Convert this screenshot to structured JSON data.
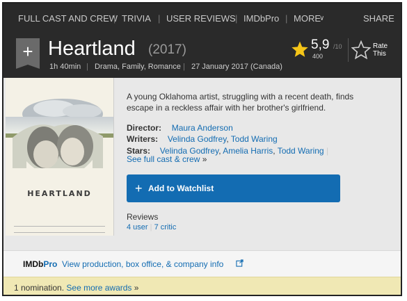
{
  "nav": {
    "items": [
      "FULL CAST AND CREW",
      "TRIVIA",
      "USER REVIEWS",
      "IMDbPro",
      "MORE"
    ],
    "share": "SHARE"
  },
  "movie": {
    "title": "Heartland",
    "year": "(2017)",
    "runtime": "1h 40min",
    "genres": "Drama, Family, Romance",
    "release": "27 January 2017 (Canada)"
  },
  "rating": {
    "value": "5,9",
    "max": "/10",
    "count": "400",
    "rate_label": "Rate This"
  },
  "poster": {
    "title_text": "HEARTLAND"
  },
  "plot": "A young Oklahoma artist, struggling with a recent death, finds escape in a reckless affair with her brother's girlfriend.",
  "credits": {
    "director_label": "Director:",
    "director": "Maura Anderson",
    "writers_label": "Writers:",
    "writers": [
      "Velinda Godfrey",
      "Todd Waring"
    ],
    "stars_label": "Stars:",
    "stars": [
      "Velinda Godfrey",
      "Amelia Harris",
      "Todd Waring"
    ],
    "see_full_cast": "See full cast & crew"
  },
  "watchlist": {
    "label": "Add to Watchlist"
  },
  "reviews": {
    "title": "Reviews",
    "user": "4 user",
    "critic": "7 critic"
  },
  "pro": {
    "logo_imdb": "IMDb",
    "logo_pro": "Pro",
    "link": "View production, box office, & company info"
  },
  "awards": {
    "text": "1 nomination.",
    "link": "See more awards"
  },
  "colors": {
    "accent_blue": "#136cb2",
    "star_yellow": "#f5c518",
    "dark_bg": "#2a2a2a",
    "award_bg": "#f0e8b4"
  }
}
